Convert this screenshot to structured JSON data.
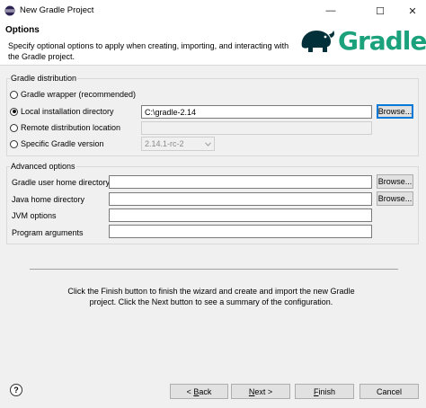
{
  "window": {
    "title": "New Gradle Project",
    "controls": {
      "minimize": "—",
      "maximize": "☐",
      "close": "✕"
    }
  },
  "header": {
    "title": "Options",
    "description": "Specify optional options to apply when creating, importing, and interacting with the Gradle project.",
    "logo_text": "Gradle",
    "brand_color": "#02303a",
    "accent_color": "#1ba27c"
  },
  "distribution": {
    "group_title": "Gradle distribution",
    "options": [
      {
        "label": "Gradle wrapper (recommended)",
        "selected": false
      },
      {
        "label": "Local installation directory",
        "selected": true
      },
      {
        "label": "Remote distribution location",
        "selected": false
      },
      {
        "label": "Specific Gradle version",
        "selected": false
      }
    ],
    "local_dir_value": "C:\\gradle-2.14",
    "remote_value": "",
    "version_value": "2.14.1-rc-2",
    "browse_label": "Browse..."
  },
  "advanced": {
    "group_title": "Advanced options",
    "fields": [
      {
        "label": "Gradle user home directory",
        "value": "",
        "browse": "Browse..."
      },
      {
        "label": "Java home directory",
        "value": "",
        "browse": "Browse..."
      },
      {
        "label": "JVM options",
        "value": ""
      },
      {
        "label": "Program arguments",
        "value": ""
      }
    ]
  },
  "info_text": "Click the Finish button to finish the wizard and create and import the new Gradle project. Click the Next button to see a summary of the configuration.",
  "footer": {
    "help": "?",
    "back": {
      "prefix": "< ",
      "mnemonic": "B",
      "rest": "ack"
    },
    "next": {
      "mnemonic": "N",
      "rest": "ext >"
    },
    "finish": {
      "mnemonic": "F",
      "rest": "inish"
    },
    "cancel": "Cancel"
  }
}
